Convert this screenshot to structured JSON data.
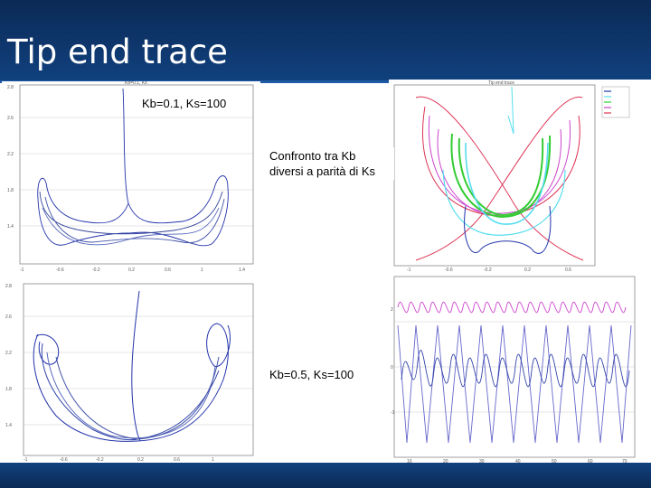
{
  "slide": {
    "title": "Tip end trace"
  },
  "labels": {
    "kb01_ks100": "Kb=0.1, Ks=100",
    "confronto": "Confronto tra Kb diversi a parità di Ks",
    "kb05_ks100": "Kb=0.5, Ks=100"
  },
  "colors": {
    "header": "#0f3a73",
    "footer": "#0b2a55",
    "trace_blue": "#2233aa",
    "trace_red": "#dd3355",
    "trace_magenta": "#cc44cc",
    "trace_green": "#33cc33",
    "trace_cyan": "#55ddee"
  }
}
